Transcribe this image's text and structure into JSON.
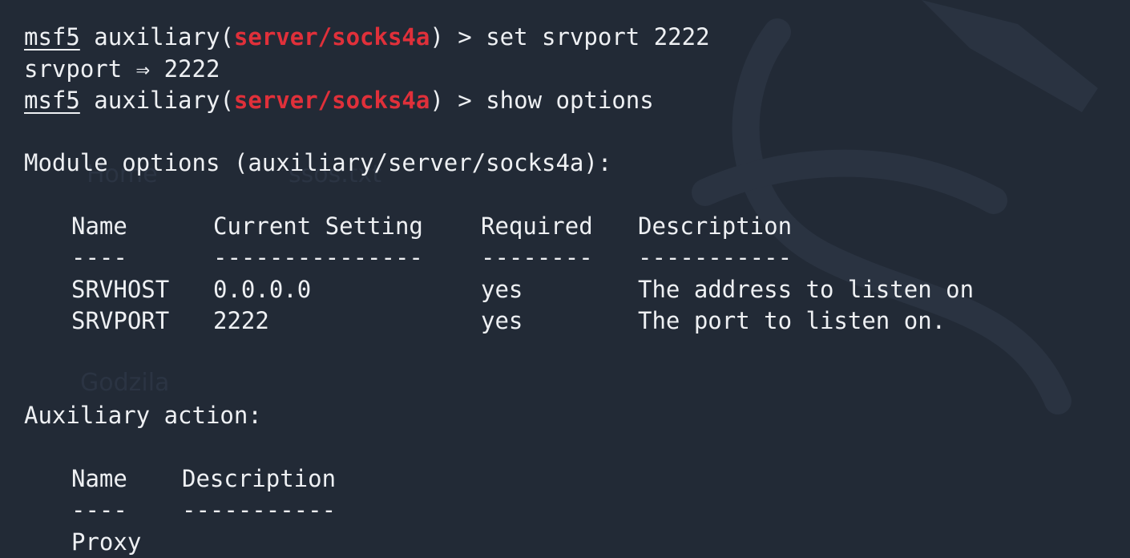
{
  "session": {
    "prompt_prefix": "msf5",
    "module_open": " auxiliary(",
    "module_path": "server/socks4a",
    "module_close": ") > ",
    "cmd1": "set srvport 2222",
    "echo": "srvport ⇒ 2222",
    "cmd2": "show options"
  },
  "module_options": {
    "title": "Module options (auxiliary/server/socks4a):",
    "headers": {
      "name": "Name",
      "setting": "Current Setting",
      "required": "Required",
      "description": "Description"
    },
    "underlines": {
      "name": "----",
      "setting": "---------------",
      "required": "--------",
      "description": "-----------"
    },
    "rows": [
      {
        "name": "SRVHOST",
        "setting": "0.0.0.0",
        "required": "yes",
        "description": "The address to listen on"
      },
      {
        "name": "SRVPORT",
        "setting": "2222",
        "required": "yes",
        "description": "The port to listen on."
      }
    ]
  },
  "auxiliary_action": {
    "title": "Auxiliary action:",
    "headers": {
      "name": "Name",
      "description": "Description"
    },
    "underlines": {
      "name": "----",
      "description": "-----------"
    },
    "rows": [
      {
        "name": "Proxy",
        "description": ""
      }
    ]
  },
  "background": {
    "ghost_label_1": "Home",
    "ghost_label_2": "Godzila",
    "ghost_label_3": "ssos.txt"
  },
  "colors": {
    "background": "#222a36",
    "text": "#eef0f3",
    "module_red": "#e0303a"
  }
}
